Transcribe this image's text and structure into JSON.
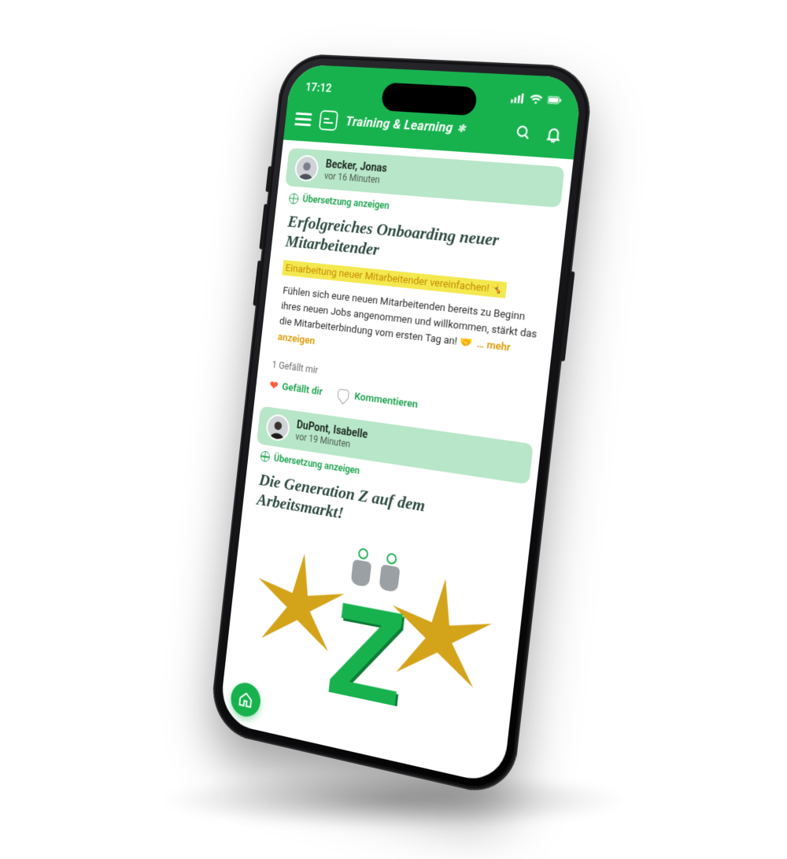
{
  "colors": {
    "brand_green": "#17b24e",
    "author_bar": "#b8e6c8",
    "highlight_bg": "#f4e84f",
    "highlight_text": "#c58a00",
    "link_green": "#18a24b",
    "heart": "#ff5b3a"
  },
  "status": {
    "time": "17:12"
  },
  "header": {
    "title": "Training & Learning"
  },
  "translate_label": "Übersetzung anzeigen",
  "actions": {
    "like": "Gefällt dir",
    "comment": "Kommentieren"
  },
  "posts": [
    {
      "author": "Becker, Jonas",
      "time": "vor 16 Minuten",
      "title": "Erfolgreiches Onboarding neuer Mitarbeitender",
      "highlight": "Einarbeitung neuer Mitarbeitender vereinfachen!",
      "highlight_emoji": "🤸",
      "body_prefix": "Fühlen sich eure neuen Mitarbeitenden bereits zu Beginn ihres neuen Jobs angenommen und willkommen, stärkt das die Mitarbeiterbindung vom ersten Tag an! ",
      "body_emoji": "🤝",
      "more_label": "… mehr anzeigen",
      "like_count": "1 Gefällt mir"
    },
    {
      "author": "DuPont, Isabelle",
      "time": "vor 19 Minuten",
      "title": "Die Generation Z auf dem Arbeitsmarkt!"
    }
  ]
}
